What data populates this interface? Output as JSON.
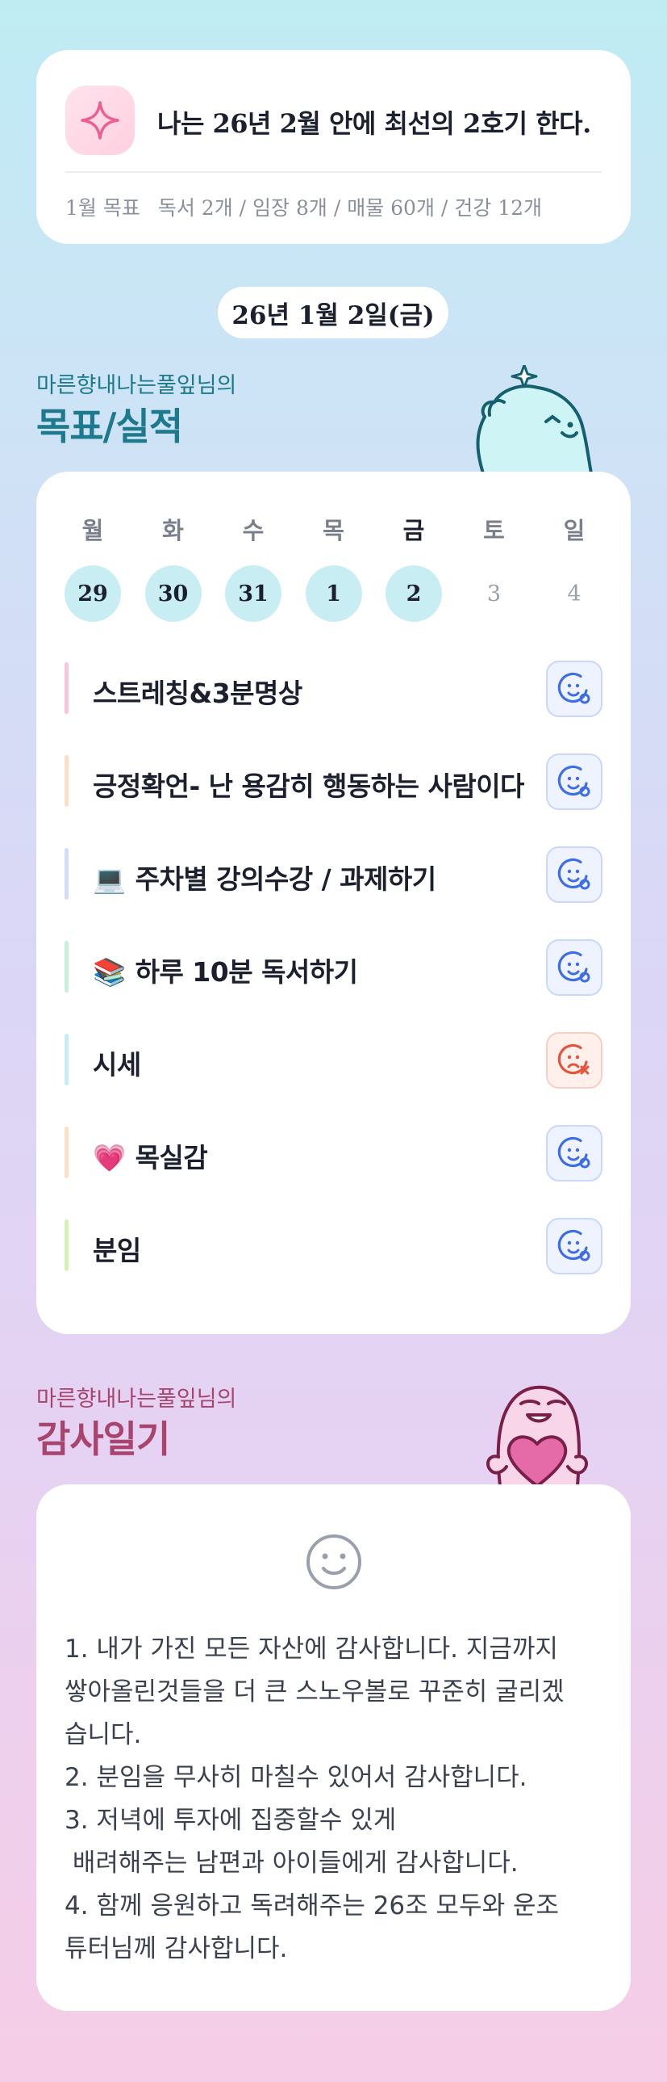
{
  "goal": {
    "title": "나는 26년 2월 안에 최선의 2호기 한다.",
    "month_label": "1월 목표",
    "month_items": "독서 2개 / 임장 8개 / 매물 60개 / 건강 12개",
    "icon": "sparkle-icon"
  },
  "date_label": "26년 1월 2일(금)",
  "goals_section": {
    "subtitle": "마른향내나는풀잎님의",
    "title": "목표/실적"
  },
  "week": {
    "days": [
      "월",
      "화",
      "수",
      "목",
      "금",
      "토",
      "일"
    ],
    "dates": [
      "29",
      "30",
      "31",
      "1",
      "2",
      "3",
      "4"
    ],
    "active_index": 4
  },
  "tasks": [
    {
      "emoji": "",
      "label": "스트레칭&3분명상",
      "bar_color": "#f7c6dd",
      "status": "done"
    },
    {
      "emoji": "",
      "label": "긍정확언- 난 용감히 행동하는 사람이다",
      "bar_color": "#fbe0c4",
      "status": "done"
    },
    {
      "emoji": "💻",
      "label": "주차별 강의수강 / 과제하기",
      "bar_color": "#d4dcf6",
      "status": "done"
    },
    {
      "emoji": "📚",
      "label": "하루 10분 독서하기",
      "bar_color": "#c8eede",
      "status": "done"
    },
    {
      "emoji": "",
      "label": "시세",
      "bar_color": "#c8ecf4",
      "status": "missed"
    },
    {
      "emoji": "💗",
      "label": "목실감",
      "bar_color": "#fbe0c4",
      "status": "done"
    },
    {
      "emoji": "",
      "label": "분임",
      "bar_color": "#d6f0b8",
      "status": "done"
    }
  ],
  "thanks_section": {
    "subtitle": "마른향내나는풀잎님의",
    "title": "감사일기",
    "lines": [
      "1. 내가 가진 모든 자산에 감사합니다. 지금까지",
      "쌓아올린것들을 더 큰 스노우볼로 꾸준히 굴리겠",
      "습니다.",
      "2. 분임을 무사히 마칠수 있어서 감사합니다.",
      "3. 저녁에 투자에 집중할수 있게",
      " 배려해주는 남편과 아이들에게 감사합니다.",
      "4. 함께 응원하고 독려해주는 26조 모두와 운조",
      "튜터님께 감사합니다."
    ]
  },
  "colors": {
    "teal_accent": "#1c7a8c",
    "plum_accent": "#a8446e",
    "done_status": "#3d6ee8",
    "missed_status": "#e5533d",
    "date_done_bg": "#c8eef4"
  }
}
